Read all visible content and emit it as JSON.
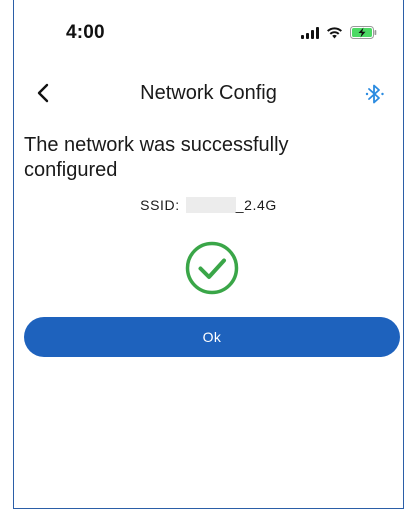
{
  "status_bar": {
    "time": "4:00"
  },
  "nav": {
    "title": "Network Config",
    "back_icon": "chevron-left-icon",
    "bluetooth_icon": "bluetooth-icon"
  },
  "main": {
    "message": "The network was successfully configured",
    "ssid_label": "SSID:",
    "ssid_value": "_2.4G",
    "success_icon": "check-circle-icon",
    "ok_label": "Ok"
  },
  "colors": {
    "accent": "#1e62bd",
    "success": "#3aa648",
    "bluetooth": "#2b8be0"
  }
}
